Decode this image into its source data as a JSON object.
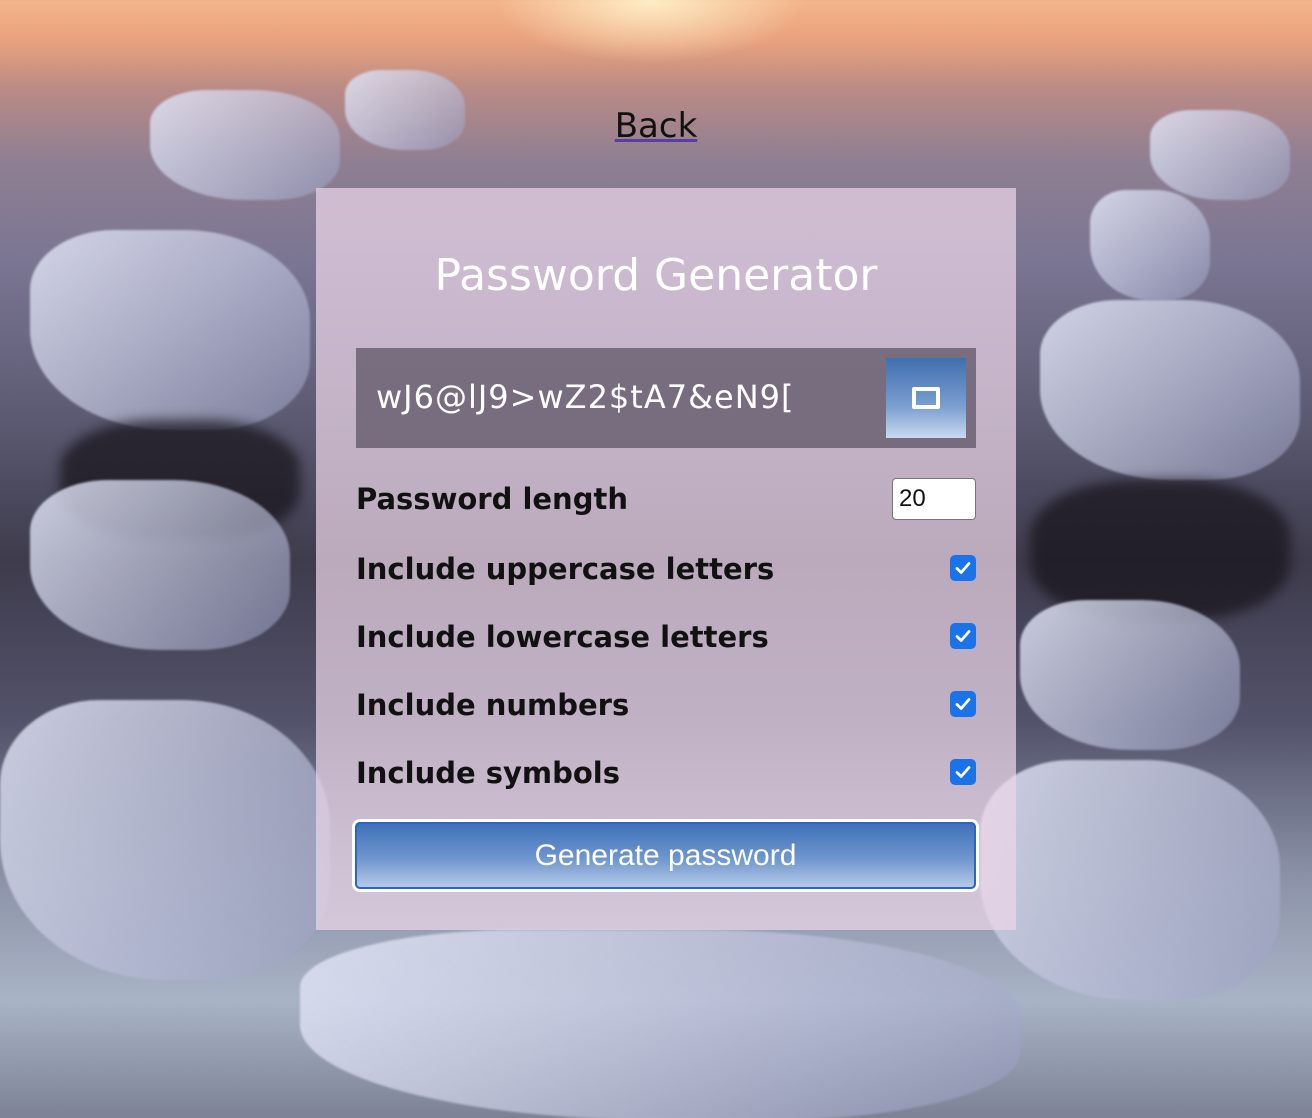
{
  "nav": {
    "back_label": "Back"
  },
  "generator": {
    "title": "Password Generator",
    "password": "wJ6@lJ9>wZ2$tA7&eN9[",
    "copy_icon": "clipboard-icon",
    "length_label": "Password length",
    "length_value": "20",
    "options": [
      {
        "label": "Include uppercase letters",
        "checked": true
      },
      {
        "label": "Include lowercase letters",
        "checked": true
      },
      {
        "label": "Include numbers",
        "checked": true
      },
      {
        "label": "Include symbols",
        "checked": true
      }
    ],
    "generate_label": "Generate password"
  },
  "colors": {
    "accent": "#1a73e8",
    "button_top": "#3d6fb8",
    "card_bg": "#ecd6e8"
  }
}
